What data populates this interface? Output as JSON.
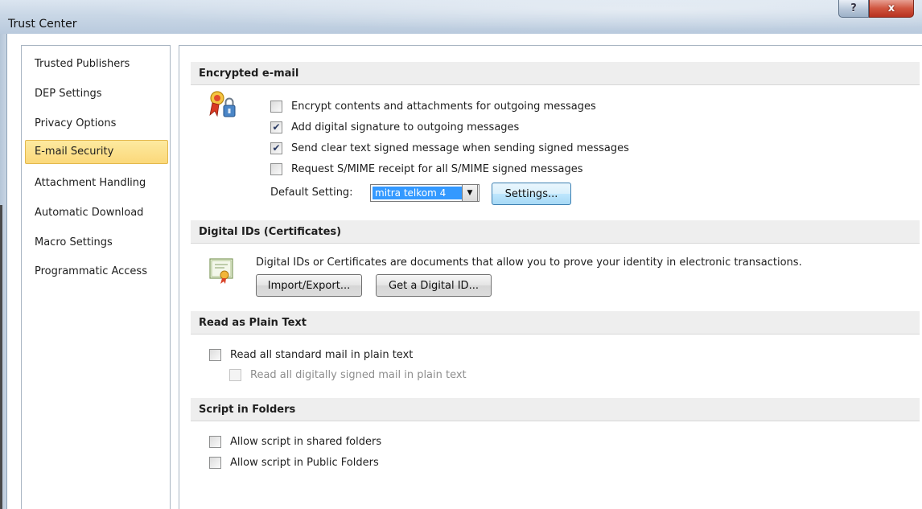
{
  "window": {
    "title": "Trust Center",
    "help_glyph": "?",
    "close_glyph": "x"
  },
  "sidebar": {
    "items": [
      {
        "label": "Trusted Publishers",
        "selected": false
      },
      {
        "label": "DEP Settings",
        "selected": false
      },
      {
        "label": "Privacy Options",
        "selected": false
      },
      {
        "label": "E-mail Security",
        "selected": true
      },
      {
        "label": "Attachment Handling",
        "selected": false
      },
      {
        "label": "Automatic Download",
        "selected": false
      },
      {
        "label": "Macro Settings",
        "selected": false
      },
      {
        "label": "Programmatic Access",
        "selected": false
      }
    ]
  },
  "encrypted_email": {
    "header": "Encrypted e-mail",
    "icon": "certificate-lock-icon",
    "options": [
      {
        "label": "Encrypt contents and attachments for outgoing messages",
        "checked": false
      },
      {
        "label": "Add digital signature to outgoing messages",
        "checked": true
      },
      {
        "label": "Send clear text signed message when sending signed messages",
        "checked": true
      },
      {
        "label": "Request S/MIME receipt for all S/MIME signed messages",
        "checked": false
      }
    ],
    "default_setting_label": "Default Setting:",
    "default_setting_value": "mitra telkom 4",
    "settings_button": "Settings..."
  },
  "digital_ids": {
    "header": "Digital IDs (Certificates)",
    "icon": "certificate-document-icon",
    "description": "Digital IDs or Certificates are documents that allow you to prove your identity in electronic transactions.",
    "import_export_button": "Import/Export...",
    "get_id_button": "Get a Digital ID..."
  },
  "plain_text": {
    "header": "Read as Plain Text",
    "options": [
      {
        "label": "Read all standard mail in plain text",
        "checked": false,
        "enabled": true
      },
      {
        "label": "Read all digitally signed mail in plain text",
        "checked": false,
        "enabled": false
      }
    ]
  },
  "script_folders": {
    "header": "Script in Folders",
    "options": [
      {
        "label": "Allow script in shared folders",
        "checked": false
      },
      {
        "label": "Allow script in Public Folders",
        "checked": false
      }
    ]
  },
  "colors": {
    "selected_nav": "#fbd87a",
    "section_header_bg": "#eeeeee",
    "combo_highlight": "#3399ff",
    "close_button": "#c8442f"
  }
}
